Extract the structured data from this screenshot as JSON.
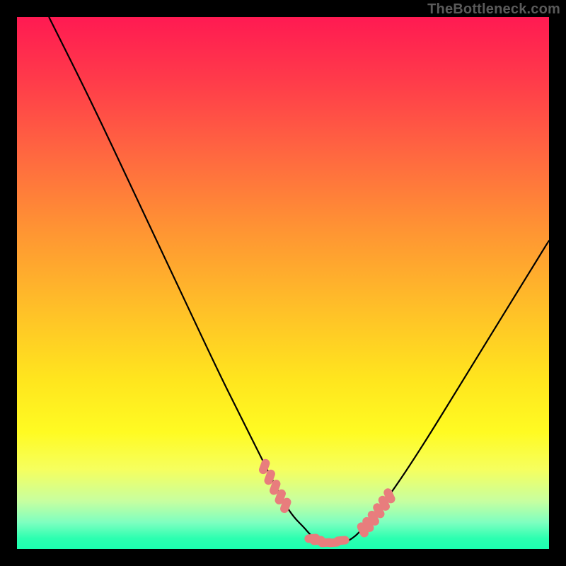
{
  "attribution": "TheBottleneck.com",
  "chart_data": {
    "type": "line",
    "title": "",
    "xlabel": "",
    "ylabel": "",
    "xlim": [
      0,
      100
    ],
    "ylim": [
      0,
      100
    ],
    "series": [
      {
        "name": "curve",
        "x": [
          6,
          14,
          22,
          30,
          38,
          42,
          46,
          50,
          52,
          54,
          55,
          56,
          57,
          58,
          59,
          60,
          61,
          62,
          63,
          64,
          66,
          70,
          76,
          84,
          92,
          100
        ],
        "values": [
          100,
          84,
          67,
          50,
          33,
          25,
          17,
          9,
          6,
          4,
          2.8,
          2.0,
          1.4,
          1.0,
          1.0,
          1.0,
          1.0,
          1.4,
          2.0,
          2.8,
          5,
          10,
          19,
          32,
          45,
          58
        ]
      }
    ],
    "markers": {
      "name": "highlight-dots",
      "color": "#e87d7d",
      "x": [
        46.5,
        47.5,
        48.5,
        49.5,
        50.5,
        55.5,
        56.5,
        58.0,
        59.5,
        61.0,
        65.0,
        66.0,
        67.0,
        68.0,
        69.0,
        70.0
      ],
      "y": [
        15.5,
        13.5,
        11.6,
        9.8,
        8.2,
        2.0,
        1.6,
        1.2,
        1.2,
        1.6,
        3.6,
        4.6,
        5.8,
        7.2,
        8.6,
        10.0
      ]
    },
    "background_gradient": {
      "direction": "vertical",
      "stops": [
        "#ff1a52",
        "#ffe51e",
        "#1cffb0"
      ]
    }
  }
}
